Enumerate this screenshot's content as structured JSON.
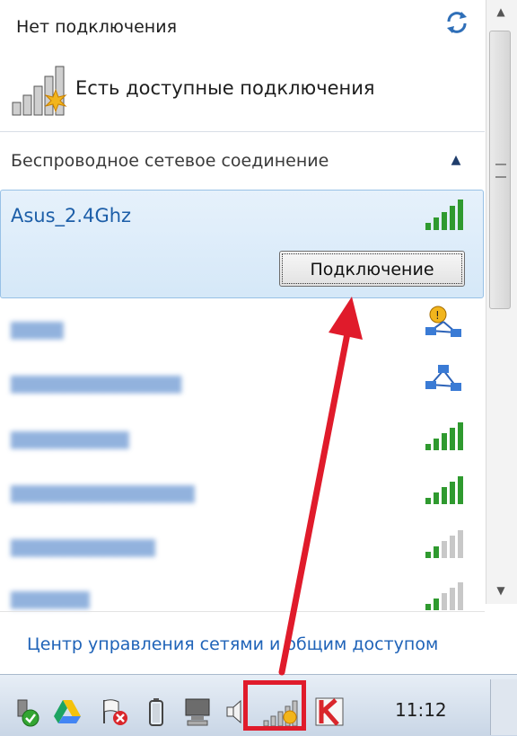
{
  "header": {
    "status": "Нет подключения",
    "availability": "Есть доступные подключения"
  },
  "section": {
    "title": "Беспроводное сетевое соединение"
  },
  "selected_network": {
    "name": "Asus_2.4Ghz",
    "signal_bars": 5,
    "connect_label": "Подключение"
  },
  "networks": [
    {
      "name": "",
      "signal": "shared-warning"
    },
    {
      "name": "",
      "signal": "shared"
    },
    {
      "name": "",
      "signal_bars": 5
    },
    {
      "name": "",
      "signal_bars": 5
    },
    {
      "name": "",
      "signal_bars": 2
    },
    {
      "name": "",
      "signal_bars": 2
    }
  ],
  "footer": {
    "link": "Центр управления сетями и общим доступом"
  },
  "taskbar": {
    "clock": "11:12",
    "tray_icons": [
      "usb-safe-remove-icon",
      "google-drive-icon",
      "action-center-flag-icon",
      "battery-icon",
      "display-icon",
      "volume-icon",
      "network-icon",
      "kaspersky-icon"
    ]
  },
  "colors": {
    "selection": "#d5e8f8",
    "link": "#1f63b8",
    "signal_green": "#2f9a2f",
    "highlight_red": "#e01b2b"
  }
}
